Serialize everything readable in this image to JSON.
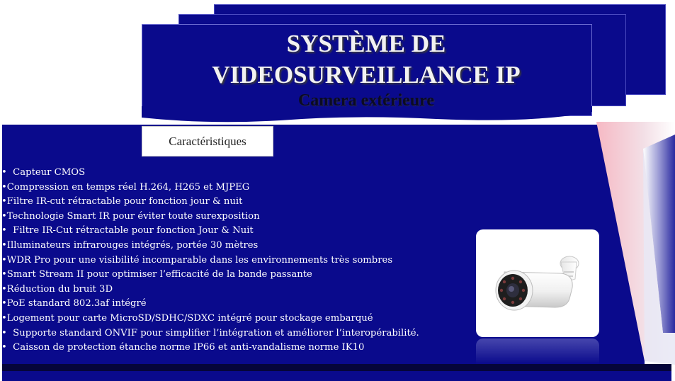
{
  "title": {
    "line1": "SYSTÈME DE",
    "line2": "VIDEOSURVEILLANCE IP",
    "subtitle": "Camera extérieure"
  },
  "tab": {
    "label": "Caractéristiques"
  },
  "features": [
    {
      "text": "Capteur CMOS",
      "indent": true
    },
    {
      "text": "Compression en temps réel H.264, H265 et MJPEG",
      "indent": false
    },
    {
      "text": "Filtre IR-cut rétractable pour fonction jour & nuit",
      "indent": false
    },
    {
      "text": "Technologie Smart IR pour éviter toute surexposition",
      "indent": false
    },
    {
      "text": "Filtre IR-Cut rétractable pour fonction Jour & Nuit",
      "indent": true
    },
    {
      "text": "Illuminateurs infrarouges intégrés, portée 30 mètres",
      "indent": false
    },
    {
      "text": "WDR Pro pour une visibilité incomparable dans les environnements très sombres",
      "indent": false
    },
    {
      "text": "Smart Stream II pour optimiser l’efficacité de la bande passante",
      "indent": false
    },
    {
      "text": "Réduction du bruit 3D",
      "indent": false
    },
    {
      "text": "PoE standard 802.3af intégré",
      "indent": false
    },
    {
      "text": "Logement pour carte MicroSD/SDHC/SDXC intégré pour stockage embarqué",
      "indent": false
    },
    {
      "text": "Supporte standard ONVIF pour simplifier l’intégration et améliorer l’interopérabilité.",
      "indent": true
    },
    {
      "text": "Caisson de protection étanche norme IP66 et anti-vandalisme norme IK10",
      "indent": true
    }
  ],
  "image": {
    "icon": "bullet-camera-icon"
  },
  "colors": {
    "primary_blue": "#0a0a8c",
    "text_white": "#ffffff",
    "subtitle_dark": "#0b0b22",
    "accent_pink": "#f6c6cf"
  }
}
